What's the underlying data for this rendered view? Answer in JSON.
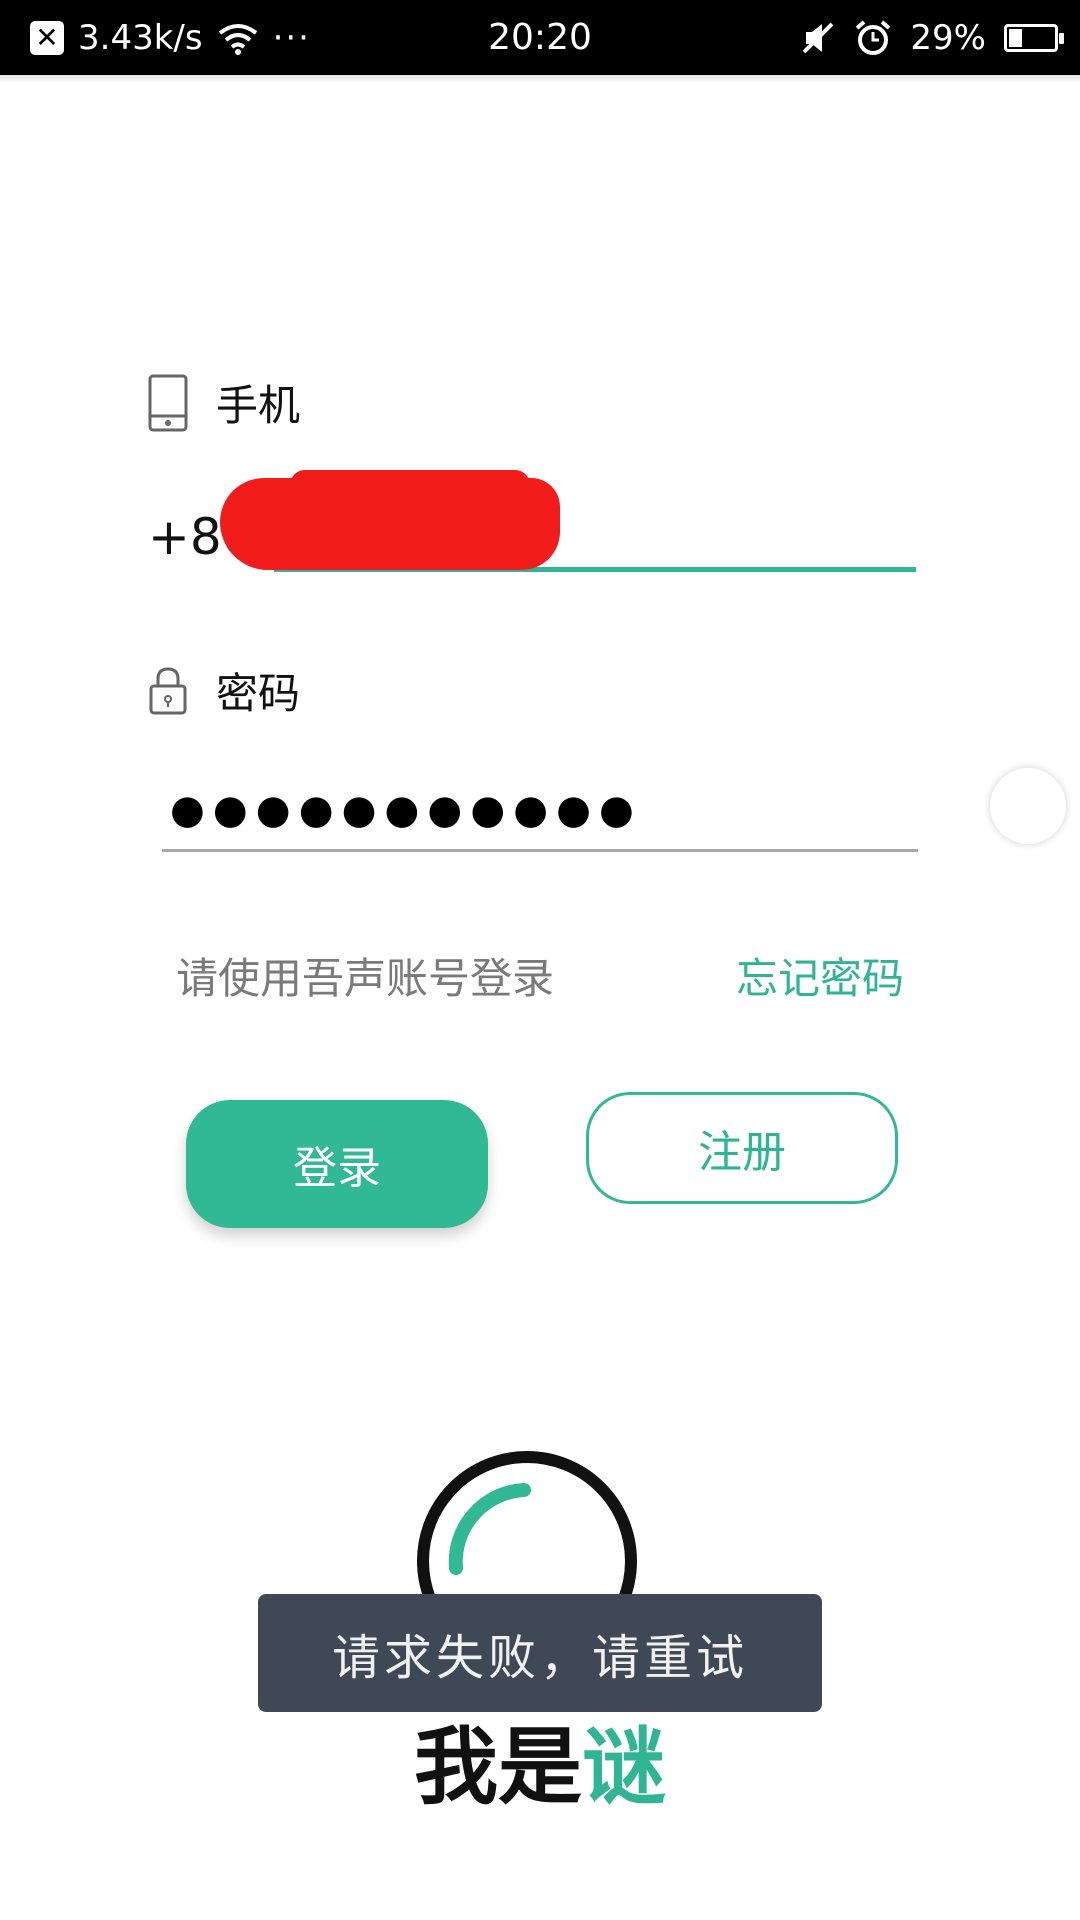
{
  "status_bar": {
    "speed": "3.43k/s",
    "more": "···",
    "time": "20:20",
    "battery_pct": "29%",
    "battery_level": 0.29,
    "icons": [
      "notification-x-icon",
      "wifi-icon",
      "mute-icon",
      "alarm-icon",
      "battery-icon"
    ]
  },
  "form": {
    "phone_label": "手机",
    "phone_prefix": "+86",
    "phone_value": "",
    "password_label": "密码",
    "password_mask": "●●●●●●●●●●●",
    "hint": "请使用吾声账号登录",
    "forgot": "忘记密码"
  },
  "buttons": {
    "login": "登录",
    "register": "注册"
  },
  "brand": {
    "part1": "我是",
    "part2": "谜"
  },
  "toast": "请求失败，请重试",
  "colors": {
    "accent": "#31b894",
    "toast_bg": "#3f4955",
    "redaction": "#f21c1c"
  }
}
